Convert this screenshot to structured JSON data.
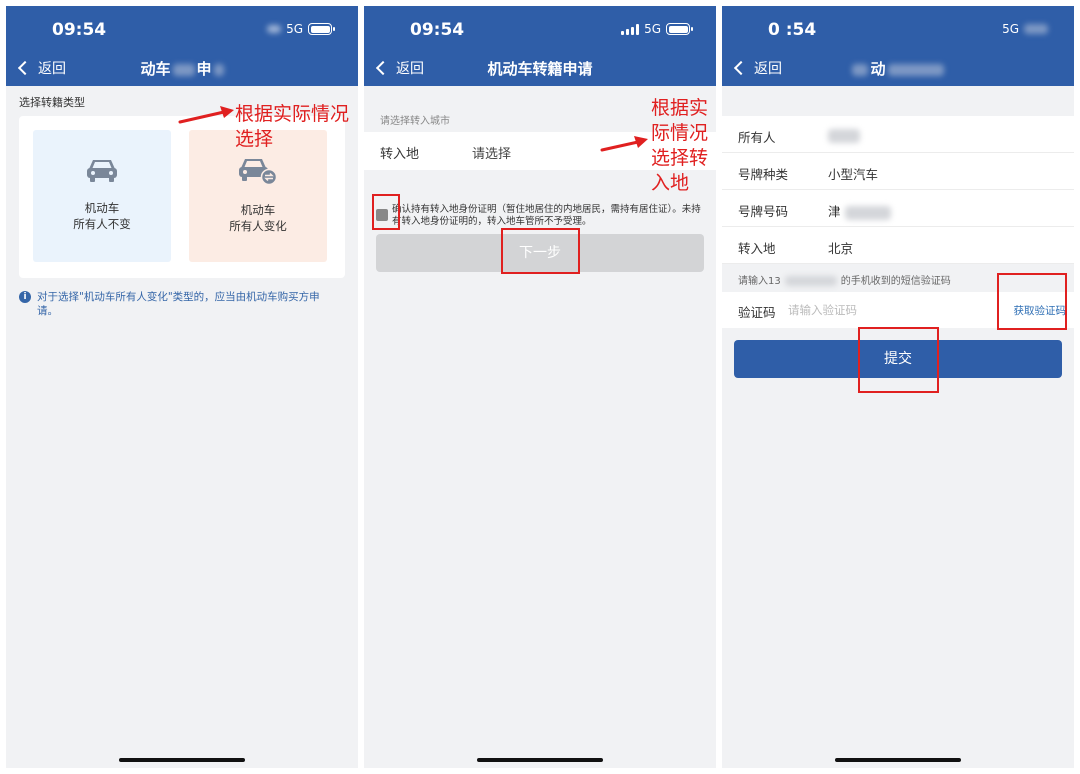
{
  "status_bar": {
    "panel1_time": "09:54",
    "panel2_time": "09:54",
    "panel3_time": "0 :54",
    "network": "5G"
  },
  "nav": {
    "back_label": "返回",
    "title_panel1_a": "动车",
    "title_panel1_b": "申",
    "title_panel2": "机动车转籍申请",
    "title_panel3": "动"
  },
  "panel1": {
    "section_label": "选择转籍类型",
    "options": [
      {
        "line1": "机动车",
        "line2": "所有人不变",
        "icon": "car-icon"
      },
      {
        "line1": "机动车",
        "line2": "所有人变化",
        "icon": "car-transfer-icon"
      }
    ],
    "note": "对于选择\"机动车所有人变化\"类型的，应当由机动车购买方申请。"
  },
  "panel2": {
    "hint": "请选择转入城市",
    "field_label": "转入地",
    "field_value": "请选择",
    "agreement": "确认持有转入地身份证明（暂住地居住的内地居民，需持有居住证）。未持有转入地身份证明的，转入地车管所不予受理。",
    "next_label": "下一步"
  },
  "panel3": {
    "rows": [
      {
        "label": "所有人",
        "value": ""
      },
      {
        "label": "号牌种类",
        "value": "小型汽车"
      },
      {
        "label": "号牌号码",
        "value": "津"
      },
      {
        "label": "转入地",
        "value": "北京"
      }
    ],
    "sms_hint_prefix": "请输入13",
    "sms_hint_suffix": "的手机收到的短信验证码",
    "code_label": "验证码",
    "code_placeholder": "请输入验证码",
    "get_code_label": "获取验证码",
    "submit_label": "提交"
  },
  "annotations": {
    "panel1_text": "根据实际情况\n选择",
    "panel2_text": "根据实\n际情况\n选择转\n入地"
  },
  "colors": {
    "header_blue": "#2f5ea8",
    "annotation_red": "#e02020",
    "link_blue": "#2f6fb5",
    "disabled_gray": "#d3d4d6"
  }
}
